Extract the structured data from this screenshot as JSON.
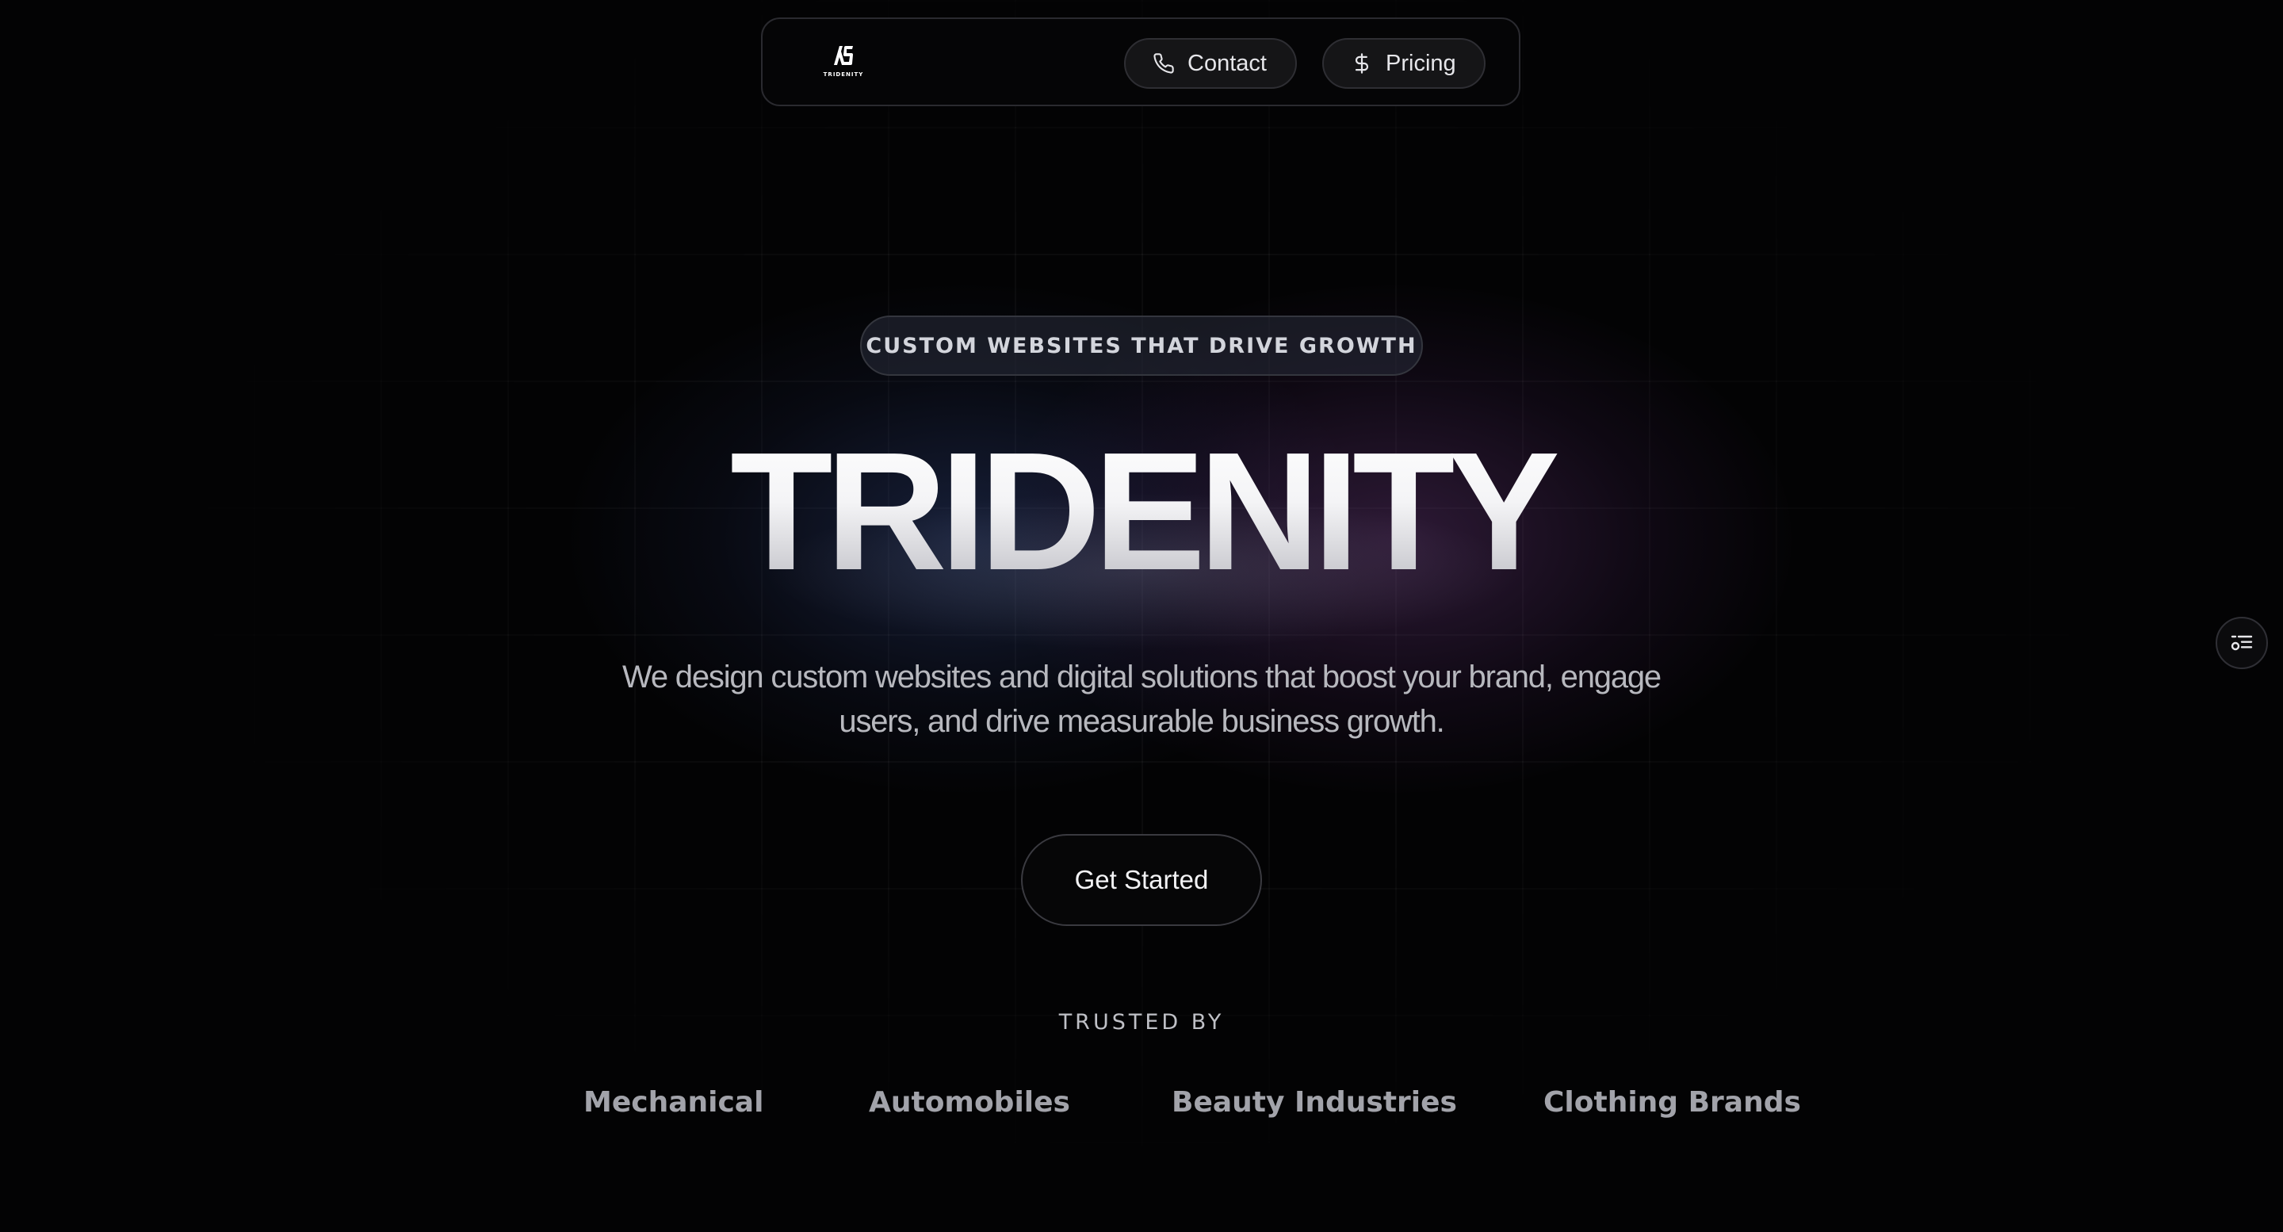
{
  "nav": {
    "logo_text": "TRIDENITY",
    "contact_label": "Contact",
    "contact_icon": "phone-icon",
    "pricing_label": "Pricing",
    "pricing_icon": "dollar-icon"
  },
  "hero": {
    "tagline": "CUSTOM WEBSITES THAT DRIVE GROWTH",
    "title": "TRIDENITY",
    "subtitle": "We design custom websites and digital solutions that boost your brand, engage users, and drive measurable business growth.",
    "cta_label": "Get Started"
  },
  "trusted": {
    "label": "TRUSTED BY",
    "brands": [
      "Mechanical",
      "Automobiles",
      "Beauty Industries",
      "Clothing Brands"
    ]
  },
  "side_widget": {
    "icon": "settings-list-icon"
  },
  "colors": {
    "background": "#030304",
    "glow_blue": "#324682",
    "glow_purple": "#6e3c82"
  }
}
